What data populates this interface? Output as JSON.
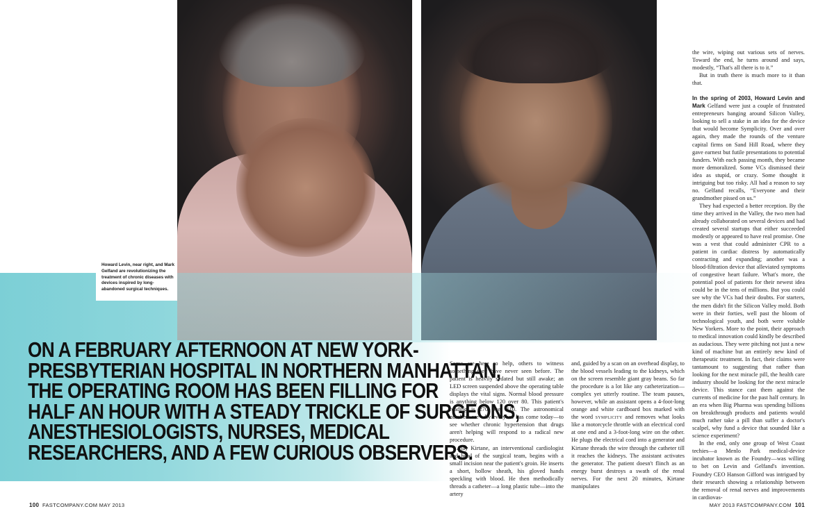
{
  "caption": "Howard Levin, near right, and Mark Gelfand are revolutionizing the treatment of chronic diseases with devices inspired by long-abandoned surgical techniques.",
  "headline": [
    "On a February afternoon at New York-",
    "Presbyterian Hospital in northern Manhattan,",
    "the operating room has been filling for",
    "half an hour with a steady trickle of surgeons,",
    "anesthesiologists, nurses, medical",
    "researchers, and a few curious observers."
  ],
  "col1": {
    "p1": "Some are here to help, others to witness something they have never seen before. The patient is heavily sedated but still awake; an LED screen suspended above the operating table displays the vital signs. Normal blood pressure is anything below 120 over 80. This patient's reading is 270 over 110. The astronomical numbers are why everyone has come today—to see whether chronic hypertension that drugs aren't helping will respond to a radical new procedure.",
    "p2": "Ajay Kirtane, an interventional cardiologist and head of the surgical team, begins with a small incision near the patient's groin. He inserts a short, hollow sheath, his gloved hands speckling with blood. He then methodically threads a catheter—a long plastic tube—into the artery"
  },
  "col2": {
    "p1_a": "and, guided by a scan on an overhead display, to the blood vessels leading to the kidneys, which on the screen resemble giant gray beans. So far the procedure is a lot like any catheterization—complex yet utterly routine. The team pauses, however, while an assistant opens a 4-foot-long orange and white cardboard box marked with the word ",
    "p1_sc": "symplicity",
    "p1_b": " and removes what looks like a motorcycle throttle with an electrical cord at one end and a 3-foot-long wire on the other. He plugs the electrical cord into a generator and Kirtane threads the wire through the catheter till it reaches the kidneys. The assistant activates the generator. The patient doesn't flinch as an energy burst destroys a swath of the renal nerves. For the next 20 minutes, Kirtane manipulates"
  },
  "col3": {
    "p1": "the wire, wiping out various sets of nerves. Toward the end, he turns around and says, modestly, “That's all there is to it.”",
    "p2": "But in truth there is much more to it than that.",
    "p3_lead": "In the spring of 2003, Howard Levin and Mark",
    "p3_rest": " Gelfand were just a couple of frustrated entrepreneurs banging around Silicon Valley, looking to sell a stake in an idea for the device that would become Symplicity. Over and over again, they made the rounds of the venture capital firms on Sand Hill Road, where they gave earnest but futile presentations to potential funders. With each passing month, they became more demoralized. Some VCs dismissed their idea as stupid, or crazy. Some thought it intriguing but too risky. All had a reason to say no. Gelfand recalls, “Everyone and their grandmother pissed on us.”",
    "p4": "They had expected a better reception. By the time they arrived in the Valley, the two men had already collaborated on several devices and had created several startups that either succeeded modestly or appeared to have real promise. One was a vest that could administer CPR to a patient in cardiac distress by automatically contracting and expanding; another was a blood-filtration device that alleviated symptoms of congestive heart failure. What's more, the potential pool of patients for their newest idea could be in the tens of millions. But you could see why the VCs had their doubts. For starters, the men didn't fit the Silicon Valley mold. Both were in their forties, well past the bloom of technological youth, and both were voluble New Yorkers. More to the point, their approach to medical innovation could kindly be described as audacious. They were pitching not just a new kind of machine but an entirely new kind of therapeutic treatment. In fact, their claims were tantamount to suggesting that rather than looking for the next miracle pill, the health care industry should be looking for the next miracle device. This stance cast them against the currents of medicine for the past half century. In an era when Big Pharma was spending billions on breakthrough products and patients would much rather take a pill than suffer a doctor's scalpel, why fund a device that sounded like a science experiment?",
    "p5": "In the end, only one group of West Coast techies—a Menlo Park medical-device incubator known as the Foundry—was willing to bet on Levin and Gelfand's invention. Foundry CEO Hanson Gifford was intrigued by their research showing a relationship between the removal of renal nerves and improvements in cardiovas-"
  },
  "footer": {
    "left_page": "100",
    "left_text": "FASTCOMPANY.COM  MAY 2013",
    "right_text": "MAY 2013  FASTCOMPANY.COM",
    "right_page": "101"
  }
}
